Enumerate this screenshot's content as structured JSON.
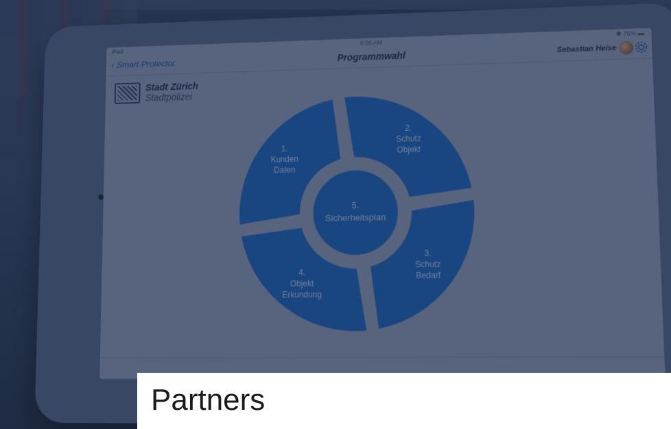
{
  "status": {
    "device": "iPad",
    "time": "8:06 AM",
    "battery": "75%"
  },
  "nav": {
    "back_label": "Smart Protector",
    "title": "Programmwahl",
    "user_name": "Sebastian Heise"
  },
  "logo": {
    "line1": "Stadt Zürich",
    "line2": "Stadtpolizei"
  },
  "wheel": {
    "color": "#1d63b8",
    "segments": [
      {
        "number": "1.",
        "line1": "Kunden",
        "line2": "Daten"
      },
      {
        "number": "2.",
        "line1": "Schutz",
        "line2": "Objekt"
      },
      {
        "number": "3.",
        "line1": "Schutz",
        "line2": "Bedarf"
      },
      {
        "number": "4.",
        "line1": "Objekt",
        "line2": "Erkundung"
      }
    ],
    "center": {
      "number": "5.",
      "label": "Sicherheitsplan"
    }
  },
  "caption": {
    "title": "Partners"
  }
}
